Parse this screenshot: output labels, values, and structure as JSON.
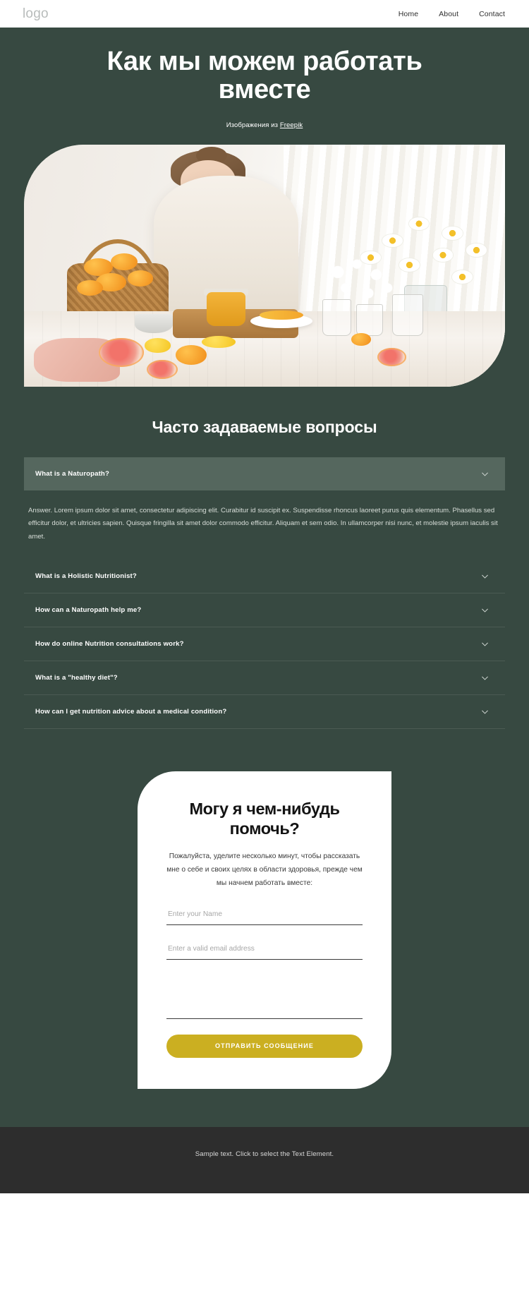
{
  "navbar": {
    "logo": "logo",
    "links": [
      {
        "label": "Home"
      },
      {
        "label": "About"
      },
      {
        "label": "Contact"
      }
    ]
  },
  "hero": {
    "title": "Как мы можем работать вместе",
    "credit_prefix": "Изображения из ",
    "credit_link": "Freepik",
    "image_alt": "Женщина выжимает апельсиновый сок на кухне рядом с корзиной цитрусовых и ромашками"
  },
  "faq": {
    "title": "Часто задаваемые вопросы",
    "items": [
      {
        "question": "What is a Naturopath?",
        "answer": "Answer. Lorem ipsum dolor sit amet, consectetur adipiscing elit. Curabitur id suscipit ex. Suspendisse rhoncus laoreet purus quis elementum. Phasellus sed efficitur dolor, et ultricies sapien. Quisque fringilla sit amet dolor commodo efficitur. Aliquam et sem odio. In ullamcorper nisi nunc, et molestie ipsum iaculis sit amet.",
        "open": true
      },
      {
        "question": "What is a Holistic Nutritionist?",
        "answer": "",
        "open": false
      },
      {
        "question": "How can a Naturopath help me?",
        "answer": "",
        "open": false
      },
      {
        "question": "How do online Nutrition consultations work?",
        "answer": "",
        "open": false
      },
      {
        "question": "What is a \"healthy diet\"?",
        "answer": "",
        "open": false
      },
      {
        "question": "How can I get nutrition advice about a medical condition?",
        "answer": "",
        "open": false
      }
    ]
  },
  "contact": {
    "title": "Могу я чем-нибудь помочь?",
    "subtitle": "Пожалуйста, уделите несколько минут, чтобы рассказать мне о себе и своих целях в области здоровья, прежде чем мы начнем работать вместе:",
    "name_placeholder": "Enter your Name",
    "name_value": "",
    "email_placeholder": "Enter a valid email address",
    "email_value": "",
    "message_placeholder": "",
    "message_value": "",
    "submit_label": "ОТПРАВИТЬ СООБЩЕНИЕ"
  },
  "footer": {
    "text": "Sample text. Click to select the Text Element."
  },
  "colors": {
    "page_bg": "#374941",
    "accent_button": "#cbaf21",
    "faq_open_bg": "#55675e",
    "footer_bg": "#2d2d2d",
    "nav_bg": "#ffffff",
    "card_bg": "#ffffff"
  },
  "icons": {
    "chevron": "chevron-down-icon"
  }
}
